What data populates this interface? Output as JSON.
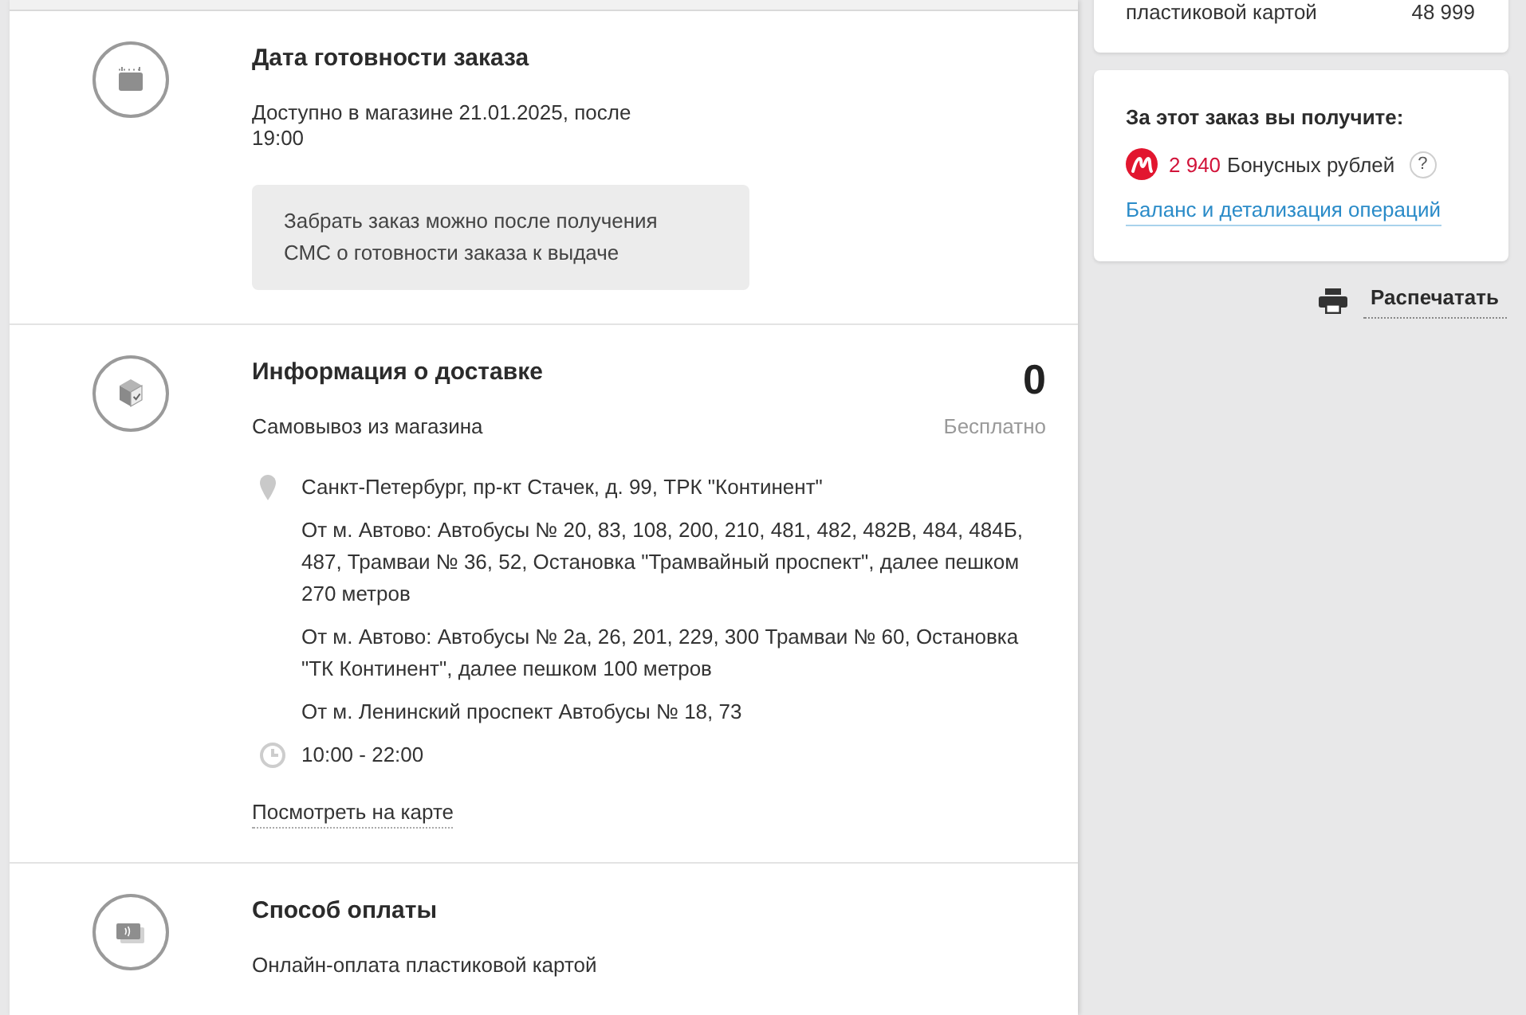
{
  "order_summary_card": {
    "payment_label": "пластиковой картой",
    "amount": "48 999"
  },
  "bonus_card": {
    "title": "За этот заказ вы получите:",
    "bonus_amount": "2 940",
    "bonus_label": "Бонусных рублей",
    "help_button": "?",
    "link": "Баланс и детализация операций"
  },
  "print_button": {
    "label": "Распечатать"
  },
  "sections": [
    {
      "kind": "ready_date",
      "title": "Дата готовности заказа",
      "text": "Доступно в магазине 21.01.2025, после 19:00",
      "note": "Забрать заказ можно после получения СМС о готовности заказа к выдаче"
    },
    {
      "kind": "delivery",
      "title": "Информация о доставке",
      "method": "Самовывоз из магазина",
      "price": "0",
      "price_note": "Бесплатно",
      "address": "Санкт-Петербург, пр-кт Стачек, д. 99, ТРК \"Континент\"",
      "directions": [
        "От м. Автово: Автобусы № 20, 83, 108, 200, 210, 481, 482, 482В, 484, 484Б, 487, Трамваи № 36, 52, Остановка \"Трамвайный проспект\", далее пешком 270 метров",
        "От м. Автово: Автобусы № 2а, 26, 201, 229, 300 Трамваи № 60, Остановка \"ТК Континент\", далее пешком 100 метров",
        "От м. Ленинский проспект Автобусы № 18, 73"
      ],
      "hours": "10:00 - 22:00",
      "map_link": "Посмотреть на карте"
    },
    {
      "kind": "payment",
      "title": "Способ оплаты",
      "text": "Онлайн-оплата пластиковой картой"
    }
  ]
}
